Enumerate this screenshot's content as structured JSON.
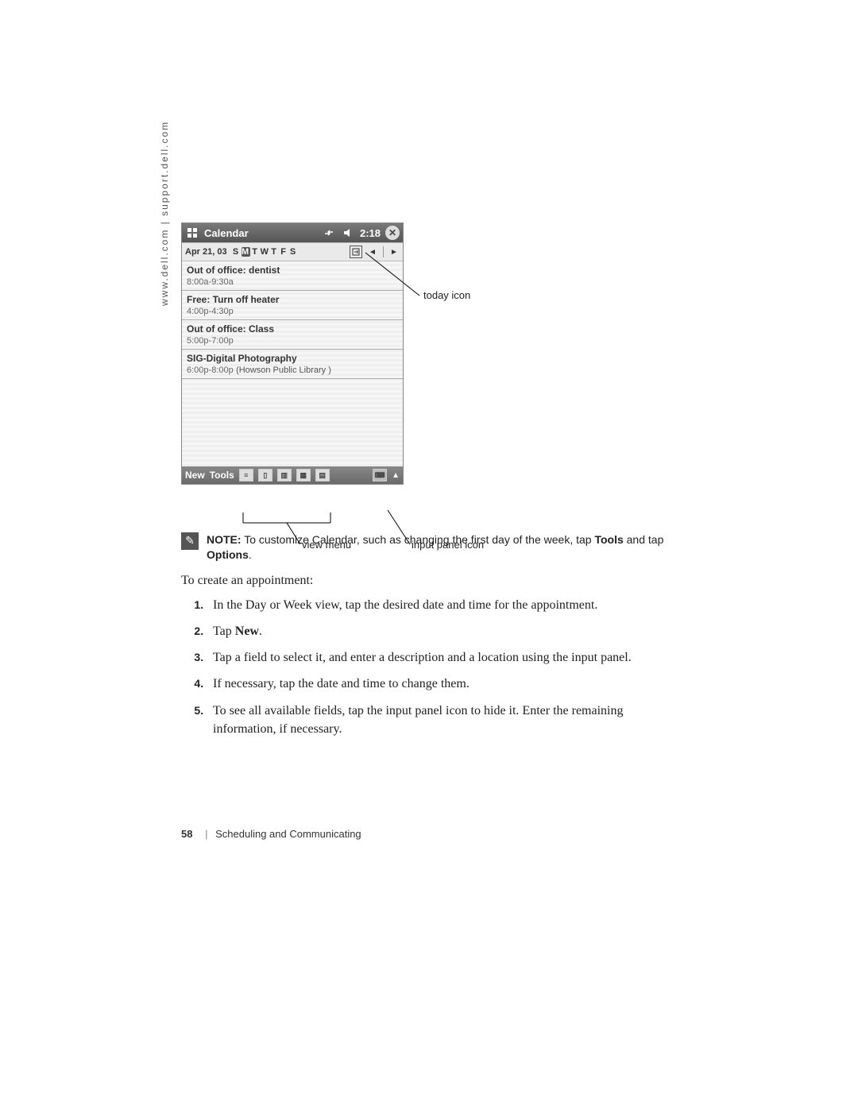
{
  "side_url": "www.dell.com | support.dell.com",
  "pda": {
    "title": "Calendar",
    "time": "2:18",
    "date": "Apr 21, 03",
    "days": [
      "S",
      "M",
      "T",
      "W",
      "T",
      "F",
      "S"
    ],
    "selected_day_index": 1,
    "appointments": [
      {
        "title": "Out of office: dentist",
        "time": "8:00a-9:30a",
        "loc": ""
      },
      {
        "title": "Free: Turn off heater",
        "time": "4:00p-4:30p",
        "loc": ""
      },
      {
        "title": "Out of office: Class",
        "time": "5:00p-7:00p",
        "loc": ""
      },
      {
        "title": "SIG-Digital Photography",
        "time": "6:00p-8:00p",
        "loc": "(Howson Public Library )"
      }
    ],
    "bottom_new": "New",
    "bottom_tools": "Tools"
  },
  "callouts": {
    "today": "today icon",
    "view_menu": "view menu",
    "input_panel": "input panel icon"
  },
  "note": {
    "label": "NOTE:",
    "body_a": " To customize Calendar, such as changing the first day of the week, tap ",
    "tools": "Tools",
    "body_b": " and tap ",
    "options": "Options",
    "body_c": "."
  },
  "intro": "To create an appointment:",
  "steps": [
    {
      "text": "In the Day or Week view, tap the desired date and time for the appointment."
    },
    {
      "text_a": "Tap ",
      "strong": "New",
      "text_b": "."
    },
    {
      "text": "Tap a field to select it, and enter a description and a location using the input panel."
    },
    {
      "text": "If necessary, tap the date and time to change them."
    },
    {
      "text": "To see all available fields, tap the input panel icon to hide it. Enter the remaining information, if necessary."
    }
  ],
  "footer": {
    "page": "58",
    "section": "Scheduling and Communicating"
  }
}
